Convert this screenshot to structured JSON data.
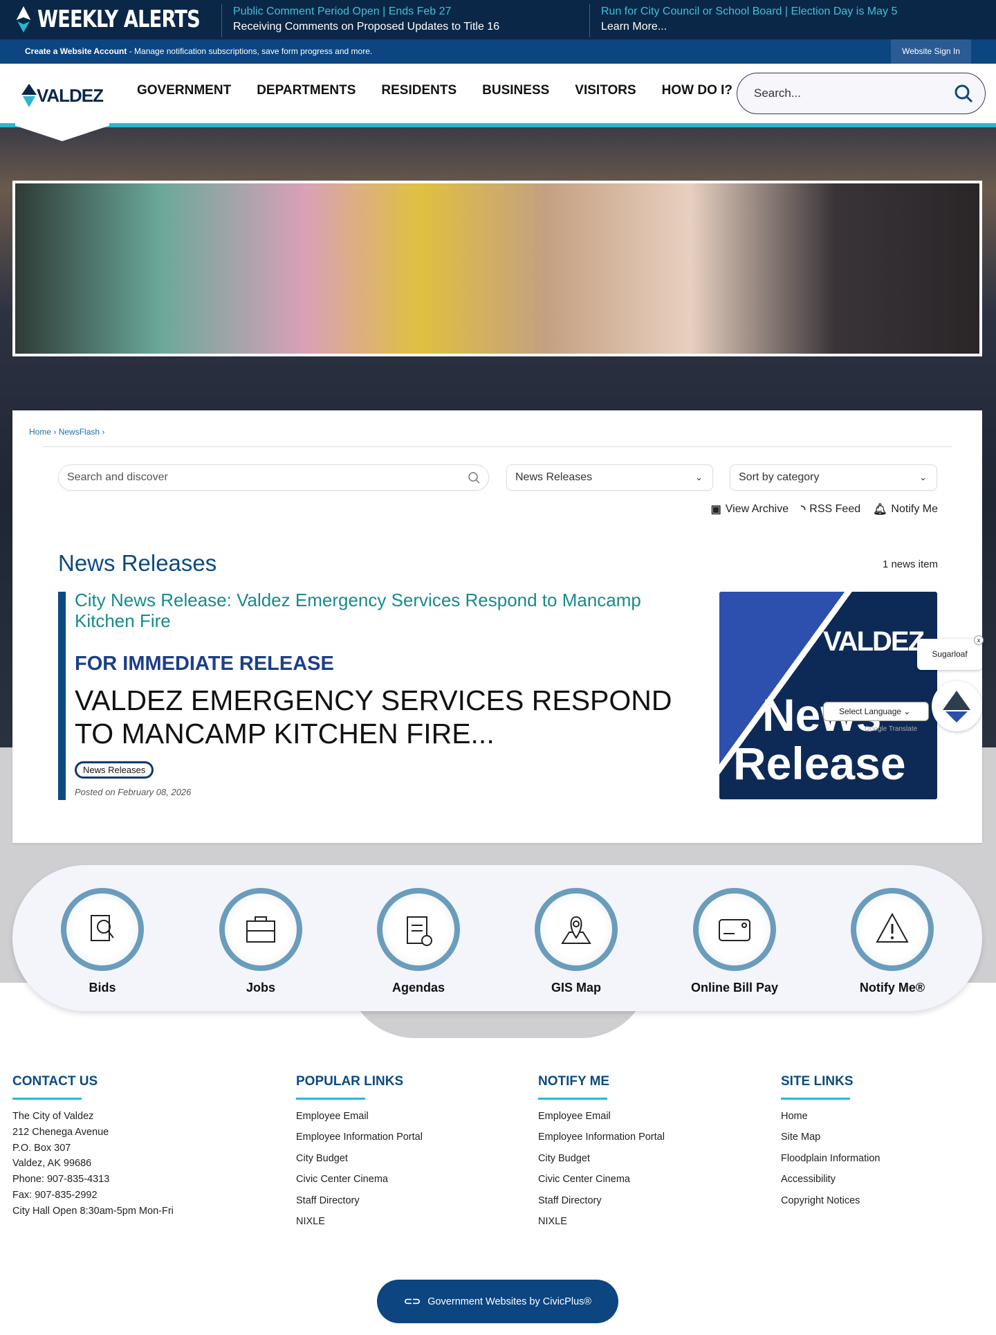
{
  "alerts": {
    "title": "WEEKLY ALERTS",
    "items": [
      {
        "title": "Public Comment Period Open | Ends Feb 27",
        "text": "Receiving Comments on Proposed Updates to Title 16"
      },
      {
        "title": "Run for City Council or School Board | Election Day is May 5",
        "text": "Learn More..."
      }
    ]
  },
  "account": {
    "bold": "Create a Website Account",
    "text": " - Manage notification subscriptions, save form progress and more.",
    "signin": "Website Sign In"
  },
  "logo": "VALDEZ",
  "nav": [
    "GOVERNMENT",
    "DEPARTMENTS",
    "RESIDENTS",
    "BUSINESS",
    "VISITORS",
    "HOW DO I?"
  ],
  "search": {
    "placeholder": "Search..."
  },
  "breadcrumb": [
    "Home",
    "NewsFlash"
  ],
  "filters": {
    "search_placeholder": "Search and discover",
    "category": "News Releases",
    "sort": "Sort by category"
  },
  "actions": [
    "View Archive",
    "RSS Feed",
    "Notify Me"
  ],
  "news": {
    "heading": "News Releases",
    "count": "1 news item",
    "item": {
      "title": "City News Release: Valdez Emergency Services Respond to Mancamp Kitchen Fire",
      "subhead": "FOR IMMEDIATE RELEASE",
      "summary": "VALDEZ EMERGENCY SERVICES RESPOND TO MANCAMP KITCHEN FIRE...",
      "tag": "News Releases",
      "posted": "Posted on February 08, 2026",
      "image": {
        "city": "VALDEZ",
        "line1": "News",
        "line2": "Release"
      }
    }
  },
  "widgets": {
    "weather": "Sugarloaf",
    "close": "x",
    "language": "Select Language",
    "translate": "Google Translate"
  },
  "quick_links": [
    {
      "label": "Bids",
      "icon": "bids-icon"
    },
    {
      "label": "Jobs",
      "icon": "briefcase-icon"
    },
    {
      "label": "Agendas",
      "icon": "clipboard-icon"
    },
    {
      "label": "GIS Map",
      "icon": "map-pin-icon"
    },
    {
      "label": "Online Bill Pay",
      "icon": "card-icon"
    },
    {
      "label": "Notify Me®",
      "icon": "alert-icon"
    }
  ],
  "footer": {
    "contact": {
      "heading": "CONTACT US",
      "lines": [
        "The City of Valdez",
        "212 Chenega Avenue",
        "P.O. Box 307",
        "Valdez, AK 99686",
        "Phone: 907-835-4313",
        "Fax: 907-835-2992",
        "City Hall Open 8:30am-5pm Mon-Fri"
      ]
    },
    "popular": {
      "heading": "POPULAR LINKS",
      "links": [
        "Employee Email",
        "Employee Information Portal",
        "City Budget",
        "Civic Center Cinema",
        "Staff Directory",
        "NIXLE"
      ]
    },
    "notify": {
      "heading": "NOTIFY ME",
      "links": [
        "Employee Email",
        "Employee Information Portal",
        "City Budget",
        "Civic Center Cinema",
        "Staff Directory",
        "NIXLE"
      ]
    },
    "site": {
      "heading": "SITE LINKS",
      "links": [
        "Home",
        "Site Map",
        "Floodplain Information",
        "Accessibility",
        "Copyright Notices"
      ]
    },
    "civicplus": "Government Websites by CivicPlus®"
  }
}
